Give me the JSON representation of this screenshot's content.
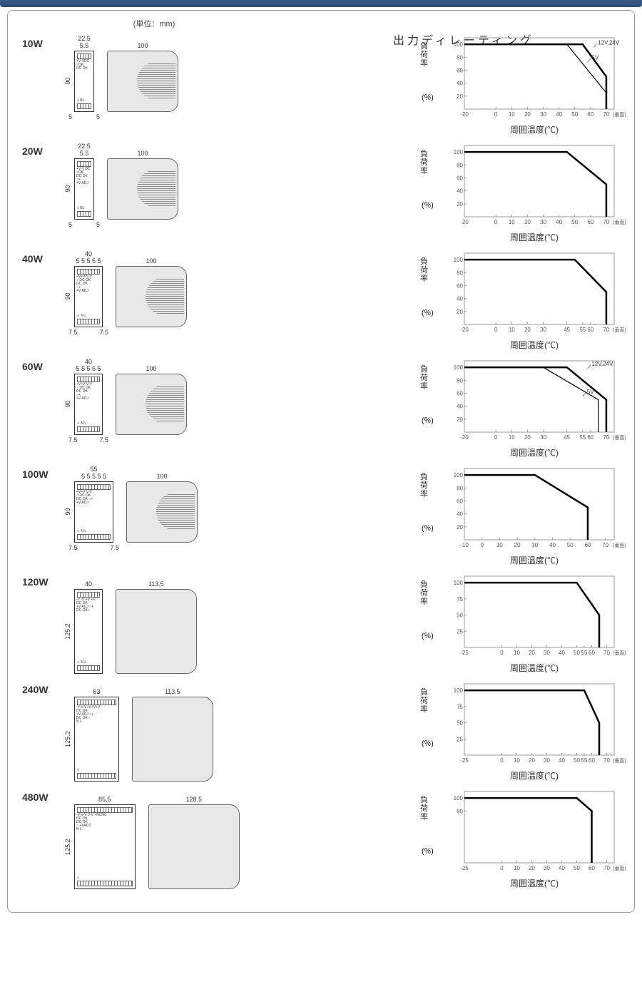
{
  "unit_note": "(単位：mm)",
  "derating_title": "出力ディレーティング",
  "ylabel_chars": [
    "負",
    "荷",
    "率"
  ],
  "ypct": "(％)",
  "xlabel": "周囲温度(℃)",
  "vert_note": "(垂直)",
  "chart_data": [
    {
      "model": "10W",
      "dims": {
        "front_w": "22.5",
        "front_w2": "5.5",
        "front_h": "90",
        "side_w": "100",
        "bl": "5",
        "br": "5"
      },
      "front_text": [
        "+V-VDC",
        "○OK",
        "DC OK",
        "⏚NL"
      ],
      "x_ticks": [
        -20,
        0,
        10,
        20,
        30,
        40,
        50,
        60,
        70
      ],
      "y_ticks": [
        20,
        40,
        60,
        80,
        100
      ],
      "series": [
        {
          "name": "12V,24V",
          "points": [
            [
              -20,
              100
            ],
            [
              55,
              100
            ],
            [
              70,
              50
            ],
            [
              70,
              0
            ]
          ]
        },
        {
          "name": "5V",
          "points": [
            [
              -20,
              100
            ],
            [
              45,
              100
            ],
            [
              70,
              25
            ],
            [
              70,
              0
            ]
          ]
        }
      ],
      "annotations": [
        {
          "text": "12V,24V",
          "x": 62,
          "y": 95
        },
        {
          "text": "5V",
          "x": 58,
          "y": 72
        }
      ]
    },
    {
      "model": "20W",
      "dims": {
        "front_w": "22.5",
        "front_w2": "5.5",
        "front_h": "90",
        "side_w": "100",
        "bl": "5",
        "br": "5"
      },
      "front_text": [
        "+V-V DC",
        "○OK",
        "DC OK",
        "○+",
        "+V ADJ",
        "⏚NL"
      ],
      "x_ticks": [
        -20,
        0,
        10,
        20,
        30,
        40,
        50,
        60,
        70
      ],
      "y_ticks": [
        20,
        40,
        60,
        80,
        100
      ],
      "series": [
        {
          "name": "",
          "points": [
            [
              -20,
              100
            ],
            [
              45,
              100
            ],
            [
              70,
              50
            ],
            [
              70,
              0
            ]
          ]
        }
      ]
    },
    {
      "model": "40W",
      "dims": {
        "front_w": "40",
        "front_w2": "5 5 5 5 5",
        "front_h": "90",
        "side_w": "100",
        "bl": "7.5",
        "br": "7.5"
      },
      "front_text": [
        "+V+V-V-V",
        "○ DC OK",
        "DC OK",
        "○+",
        "+V ADJ",
        "⏚ N L"
      ],
      "x_ticks": [
        -20,
        0,
        10,
        20,
        30,
        45,
        55,
        60,
        70
      ],
      "y_ticks": [
        20,
        40,
        60,
        80,
        100
      ],
      "series": [
        {
          "name": "",
          "points": [
            [
              -20,
              100
            ],
            [
              50,
              100
            ],
            [
              70,
              50
            ],
            [
              70,
              0
            ]
          ]
        }
      ]
    },
    {
      "model": "60W",
      "dims": {
        "front_w": "40",
        "front_w2": "5 5 5 5 5",
        "front_h": "90",
        "side_w": "100",
        "bl": "7.5",
        "br": "7.5"
      },
      "front_text": [
        "+V+V-V-V",
        "○ DC OK",
        "DC OK",
        "○+",
        "+V ADJ",
        "⏚ N L"
      ],
      "x_ticks": [
        -20,
        0,
        10,
        20,
        30,
        45,
        55,
        60,
        70
      ],
      "y_ticks": [
        20,
        40,
        60,
        80,
        100
      ],
      "series": [
        {
          "name": "12V,24V",
          "points": [
            [
              -20,
              100
            ],
            [
              45,
              100
            ],
            [
              70,
              50
            ],
            [
              70,
              0
            ]
          ]
        },
        {
          "name": "5V",
          "points": [
            [
              -20,
              100
            ],
            [
              30,
              100
            ],
            [
              65,
              50
            ],
            [
              65,
              0
            ]
          ]
        }
      ],
      "annotations": [
        {
          "text": "12V,24V",
          "x": 58,
          "y": 98
        },
        {
          "text": "5V",
          "x": 55,
          "y": 55
        }
      ]
    },
    {
      "model": "100W",
      "dims": {
        "front_w": "55",
        "front_w2": "5 5 5 5 5",
        "front_h": "90",
        "side_w": "100",
        "bl": "7.5",
        "br": "7.5"
      },
      "front_text": [
        "+V+V-V-V",
        "○ DC OK",
        "DC OK ○+",
        "+V ADJ",
        "⏚ N L"
      ],
      "x_ticks": [
        -10,
        0,
        10,
        20,
        30,
        40,
        50,
        60,
        70
      ],
      "y_ticks": [
        20,
        40,
        60,
        80,
        100
      ],
      "series": [
        {
          "name": "",
          "points": [
            [
              -10,
              100
            ],
            [
              30,
              100
            ],
            [
              60,
              50
            ],
            [
              60,
              0
            ]
          ]
        }
      ]
    },
    {
      "model": "120W",
      "dims": {
        "front_w": "40",
        "front_h": "125.2",
        "side_w": "113.5"
      },
      "front_text": [
        "-V -V +V +V",
        "DC OK",
        "+V ADJ ○+",
        "DC OK○",
        "⏚ N L"
      ],
      "x_ticks": [
        -25,
        0,
        10,
        20,
        30,
        40,
        50,
        55,
        60,
        70
      ],
      "y_ticks": [
        25,
        50,
        75,
        100
      ],
      "series": [
        {
          "name": "",
          "points": [
            [
              -25,
              100
            ],
            [
              50,
              100
            ],
            [
              65,
              50
            ],
            [
              65,
              0
            ]
          ]
        }
      ]
    },
    {
      "model": "240W",
      "dims": {
        "front_w": "63",
        "front_h": "125.2",
        "side_w": "113.5"
      },
      "front_text": [
        "-V-V-V+V+V+V",
        "DC OK",
        "+V ADJ ○+",
        "DC OK○",
        "N L",
        "⏚"
      ],
      "x_ticks": [
        -25,
        0,
        10,
        20,
        30,
        40,
        50,
        55,
        60,
        70
      ],
      "y_ticks": [
        25,
        50,
        75,
        100
      ],
      "series": [
        {
          "name": "",
          "points": [
            [
              -25,
              100
            ],
            [
              55,
              100
            ],
            [
              65,
              50
            ],
            [
              65,
              0
            ]
          ]
        }
      ]
    },
    {
      "model": "480W",
      "dims": {
        "front_w": "85.5",
        "front_h": "125.2",
        "side_w": "128.5"
      },
      "front_text": [
        "-V-V-V-V-V +NCNC",
        "DC OK",
        "DC OK",
        "○ +VADJ",
        "N L",
        "⏚"
      ],
      "x_ticks": [
        -25,
        0,
        10,
        20,
        30,
        40,
        50,
        60,
        70
      ],
      "y_ticks": [
        80,
        100
      ],
      "series": [
        {
          "name": "",
          "points": [
            [
              -25,
              100
            ],
            [
              50,
              100
            ],
            [
              60,
              80
            ],
            [
              60,
              0
            ]
          ]
        }
      ]
    }
  ]
}
